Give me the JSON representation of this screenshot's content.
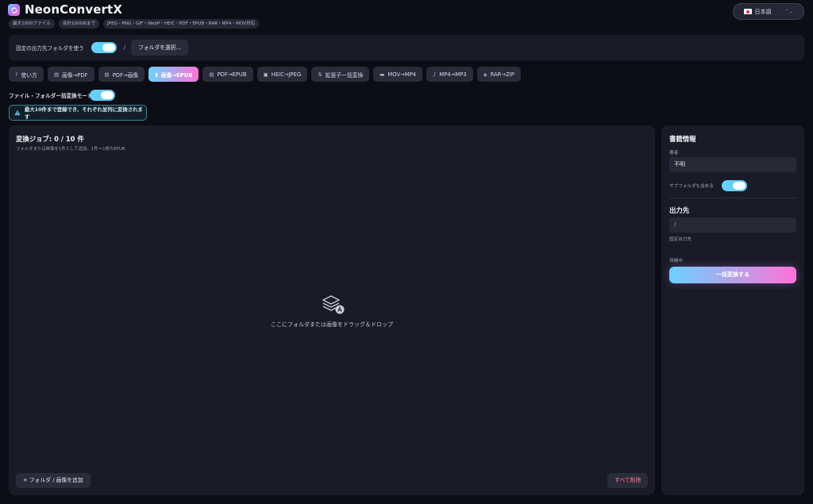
{
  "header": {
    "app_title": "NeonConvertX",
    "chips": [
      "最大1000ファイル",
      "合計100GBまで",
      "JPEG・PNG・GIF・WebP・HEIC・PDF・EPUB・RAR・MP4・MOV対応"
    ],
    "language": "日本語"
  },
  "fixed_folder": {
    "label": "固定の出力先フォルダを使う",
    "path": "/",
    "select_button": "フォルダを選択..."
  },
  "tabs": [
    {
      "label": "使い方",
      "icon": "help-icon",
      "glyph": "?"
    },
    {
      "label": "画像→PDF",
      "icon": "file-icon",
      "glyph": "▤"
    },
    {
      "label": "PDF→画像",
      "icon": "file-icon",
      "glyph": "▤"
    },
    {
      "label": "画像→EPUB",
      "icon": "book-icon",
      "glyph": "▮"
    },
    {
      "label": "PDF→EPUB",
      "icon": "file-icon",
      "glyph": "▤"
    },
    {
      "label": "HEIC→JPEG",
      "icon": "image-icon",
      "glyph": "▣"
    },
    {
      "label": "拡張子一括変換",
      "icon": "swap-icon",
      "glyph": "⇅"
    },
    {
      "label": "MOV→MP4",
      "icon": "film-icon",
      "glyph": "▬"
    },
    {
      "label": "MP4→MP3",
      "icon": "music-icon",
      "glyph": "♪"
    },
    {
      "label": "RAR→ZIP",
      "icon": "archive-icon",
      "glyph": "◈"
    }
  ],
  "active_tab": 3,
  "bulk_mode": {
    "label": "ファイル・フォルダー括変換モード"
  },
  "info_banner": "最大10件まで登録でき、それぞれ並列に変換されます",
  "main": {
    "job_title": "変換ジョブ: 0 / 10 件",
    "job_sub": "フォルダまたは画像を1件として追加。1件＝1冊のEPUB",
    "drop_text": "ここにフォルダまたは画像をドラッグ＆ドロップ",
    "add_button": "+ フォルダ / 画像を追加",
    "clear_button": "すべて削除"
  },
  "side": {
    "book_info_title": "書籍情報",
    "author_label": "著者",
    "author_value": "不明",
    "subfolder_label": "サブフォルダも含める",
    "output_title": "出力先",
    "output_value": "/",
    "output_note": "固定出力先",
    "status": "待機中",
    "convert_button": "一括変換する"
  },
  "colors": {
    "accent_start": "#6ad3ff",
    "accent_end": "#ff72d6",
    "danger": "#ff7b9e",
    "panel": "#1a1b26"
  }
}
